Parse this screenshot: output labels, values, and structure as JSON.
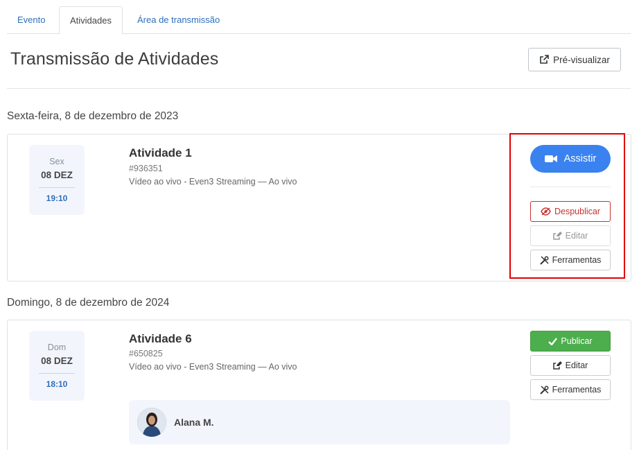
{
  "tabs": [
    {
      "label": "Evento"
    },
    {
      "label": "Atividades"
    },
    {
      "label": "Área de transmissão"
    }
  ],
  "header": {
    "title": "Transmissão de Atividades",
    "preview_label": "Pré-visualizar"
  },
  "sections": [
    {
      "date_heading": "Sexta-feira, 8 de dezembro de 2023",
      "activity": {
        "dow": "Sex",
        "day": "08 DEZ",
        "time": "19:10",
        "title": "Atividade 1",
        "id": "#936351",
        "type": "Vídeo ao vivo - Even3 Streaming — Ao vivo",
        "watch_label": "Assistir",
        "unpublish_label": "Despublicar",
        "edit_label": "Editar",
        "tools_label": "Ferramentas"
      }
    },
    {
      "date_heading": "Domingo, 8 de dezembro de 2024",
      "activity": {
        "dow": "Dom",
        "day": "08 DEZ",
        "time": "18:10",
        "title": "Atividade 6",
        "id": "#650825",
        "type": "Vídeo ao vivo - Even3 Streaming — Ao vivo",
        "publish_label": "Publicar",
        "edit_label": "Editar",
        "tools_label": "Ferramentas",
        "speaker": {
          "name": "Alana M."
        }
      }
    }
  ],
  "colors": {
    "accent_blue": "#3a82f0",
    "link_blue": "#2f6fba",
    "danger_red": "#c9302c",
    "success_green": "#4cae4c",
    "highlight_red": "#e00000"
  }
}
